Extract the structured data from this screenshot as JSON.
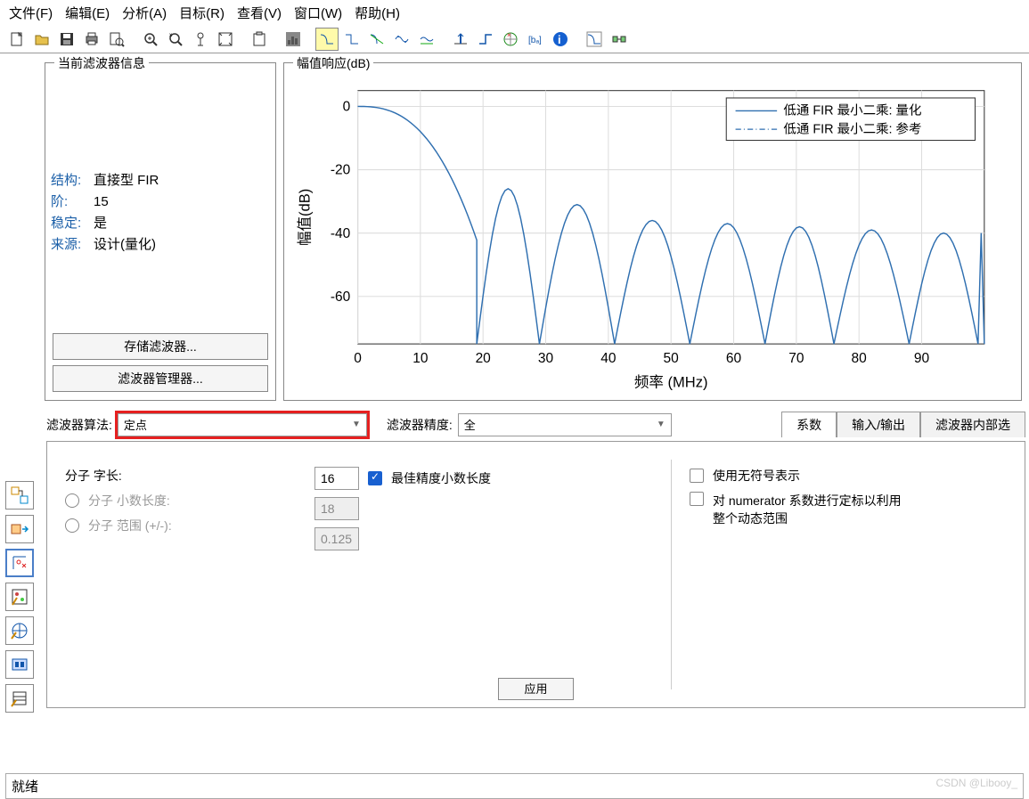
{
  "menus": [
    "文件(F)",
    "编辑(E)",
    "分析(A)",
    "目标(R)",
    "查看(V)",
    "窗口(W)",
    "帮助(H)"
  ],
  "info_panel": {
    "title": "当前滤波器信息",
    "rows": [
      {
        "label": "结构:",
        "value": "直接型 FIR"
      },
      {
        "label": "阶:",
        "value": "15"
      },
      {
        "label": "稳定:",
        "value": "是"
      },
      {
        "label": "来源:",
        "value": "设计(量化)"
      }
    ],
    "store_btn": "存储滤波器...",
    "mgr_btn": "滤波器管理器..."
  },
  "chart_title": "幅值响应(dB)",
  "chart_data": {
    "type": "line",
    "xlabel": "频率 (MHz)",
    "ylabel": "幅值(dB)",
    "xlim": [
      0,
      100
    ],
    "ylim": [
      -75,
      5
    ],
    "xticks": [
      0,
      10,
      20,
      30,
      40,
      50,
      60,
      70,
      80,
      90
    ],
    "yticks": [
      0,
      -20,
      -40,
      -60
    ],
    "legend": [
      "低通 FIR 最小二乘: 量化",
      "低通 FIR 最小二乘: 参考"
    ],
    "notch_freqs": [
      19,
      29,
      41,
      53,
      65,
      76,
      88,
      99
    ],
    "lobe_peaks": [
      -26,
      -31,
      -36,
      -37,
      -38,
      -39,
      -40,
      -40
    ]
  },
  "filter_algo": {
    "label": "滤波器算法:",
    "value": "定点"
  },
  "filter_prec": {
    "label": "滤波器精度:",
    "value": "全"
  },
  "tabs": [
    "系数",
    "输入/输出",
    "滤波器内部选"
  ],
  "fields": {
    "num_wl": {
      "label": "分子 字长:",
      "value": "16"
    },
    "best_prec": "最佳精度小数长度",
    "num_fl": {
      "label": "分子 小数长度:",
      "value": "18"
    },
    "num_range": {
      "label": "分子 范围 (+/-):",
      "value": "0.125"
    },
    "unsigned": "使用无符号表示",
    "scale": "对 numerator 系数进行定标以利用整个动态范围"
  },
  "apply": "应用",
  "status": "就绪",
  "watermark": "CSDN @Libooy_"
}
